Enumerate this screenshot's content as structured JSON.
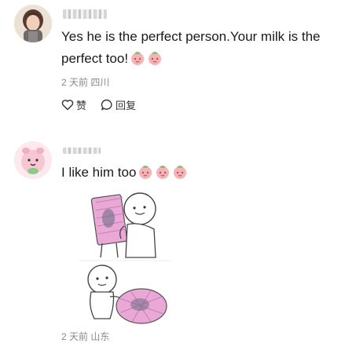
{
  "comments": [
    {
      "text": "Yes he is the perfect person.Your milk is the perfect too!",
      "meta": "2 天前 四川",
      "actions": {
        "like_label": "赞",
        "reply_label": "回复"
      }
    },
    {
      "text": "I like him too",
      "meta": "2 天前 山东"
    }
  ],
  "icons": {
    "peach_emoji": "peach-face-emoji",
    "heart": "heart-icon",
    "reply": "reply-bubble-icon"
  },
  "colors": {
    "text": "#1a1a1a",
    "meta": "#8a8a8a",
    "emoji_pink": "#f4a0a6",
    "sticker_pink": "#e8a6d0"
  }
}
